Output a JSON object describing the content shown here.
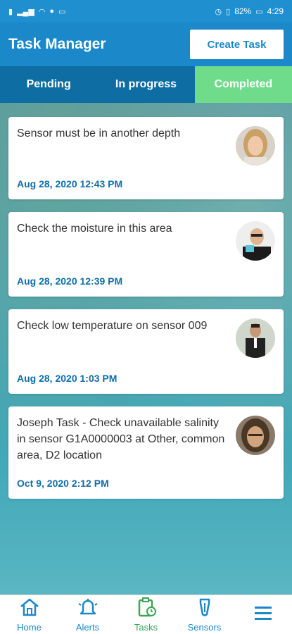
{
  "status_bar": {
    "battery": "82%",
    "time": "4:29"
  },
  "header": {
    "title": "Task Manager",
    "create_label": "Create Task"
  },
  "tabs": [
    {
      "label": "Pending",
      "active": false
    },
    {
      "label": "In progress",
      "active": false
    },
    {
      "label": "Completed",
      "active": true
    }
  ],
  "tasks": [
    {
      "text": "Sensor must be in another depth",
      "date": "Aug 28, 2020 12:43 PM"
    },
    {
      "text": "Check the moisture in this area",
      "date": "Aug 28, 2020 12:39 PM"
    },
    {
      "text": "Check low temperature on sensor 009",
      "date": "Aug 28, 2020 1:03 PM"
    },
    {
      "text": "Joseph Task - Check unavailable salinity in sensor G1A0000003 at Other, common area, D2 location",
      "date": "Oct 9, 2020 2:12 PM"
    }
  ],
  "bottom_nav": [
    {
      "label": "Home",
      "icon": "home-icon"
    },
    {
      "label": "Alerts",
      "icon": "bell-icon"
    },
    {
      "label": "Tasks",
      "icon": "tasks-icon",
      "active": true
    },
    {
      "label": "Sensors",
      "icon": "sensor-icon"
    },
    {
      "label": "",
      "icon": "menu-icon"
    }
  ],
  "colors": {
    "primary": "#1a88c9",
    "tab_bar": "#0e6ea3",
    "active_tab": "#6fdc8c",
    "date_text": "#0f6ea8",
    "active_nav": "#3aa655"
  }
}
